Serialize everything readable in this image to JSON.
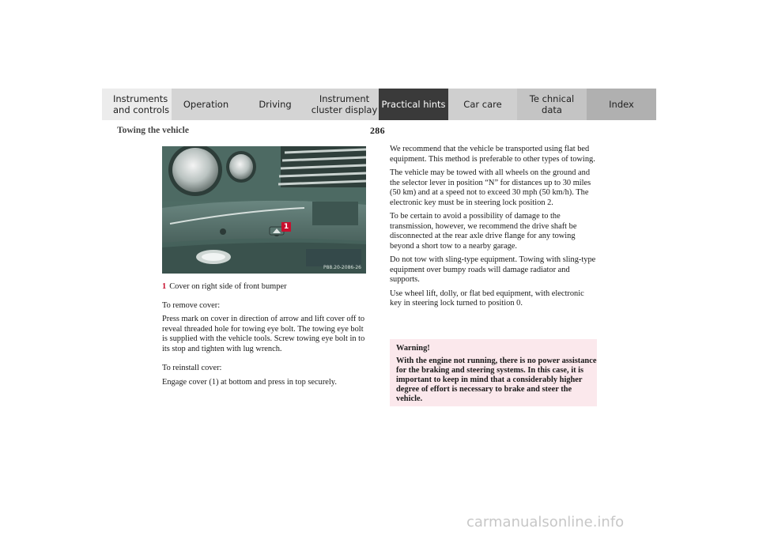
{
  "nav": {
    "tabs": [
      {
        "label": "Instruments and controls",
        "line1": "Instruments",
        "line2": "and controls"
      },
      {
        "label": "Operation"
      },
      {
        "label": "Driving"
      },
      {
        "label": "Instrument cluster display",
        "line1": "Instrument",
        "line2": "cluster display"
      },
      {
        "label": "Practical hints"
      },
      {
        "label": "Car care"
      },
      {
        "label": "Technical data",
        "line1": "Te chnical",
        "line2": "data"
      },
      {
        "label": "Index"
      }
    ],
    "active_tab": "Practical hints",
    "active_color": "#3a3a3a"
  },
  "header": {
    "page_number": "286",
    "section_title": "Towing the vehicle"
  },
  "figure": {
    "code": "P88.20-2086-26",
    "callout": "1",
    "caption_number": "1",
    "caption_text": "Cover on right side of front bumper"
  },
  "left": {
    "remove_heading": "To remove cover:",
    "remove_body": "Press mark on cover in direction of arrow and lift cover off to reveal threaded hole for towing eye bolt. The towing eye bolt is supplied with the vehicle tools. Screw towing eye bolt in to its stop and tighten with lug wrench.",
    "reinstall_heading": "To reinstall cover:",
    "reinstall_body": "Engage cover (1) at bottom and press in top securely."
  },
  "right": {
    "p1": "We recommend that the vehicle be transported using flat bed equipment. This method is preferable to other types of towing.",
    "p2": "The vehicle may be towed with all wheels on the ground and the selector lever in position “N” for distances up to 30 miles (50 km) and at a speed not to exceed 30 mph (50 km/h). The electronic key must be in steering lock position 2.",
    "p3": "To be certain to avoid a possibility of damage to the transmission, however, we recommend the drive shaft be disconnected at the rear axle drive flange for any towing beyond a short tow to a nearby garage.",
    "p4": "Do not tow with sling-type equipment. Towing with sling-type equipment over bumpy roads will damage radiator and supports.",
    "p5": "Use wheel lift, dolly, or flat bed equipment, with electronic key in steering lock turned to position 0."
  },
  "warning": {
    "title": "Warning!",
    "body": "With the engine not running, there is no power assistance for the braking and steering systems. In this case, it is important to keep in mind that a considerably higher degree of effort is necessary to brake and steer the vehicle.",
    "background": "#fbe8ec"
  },
  "watermark": "carmanualsonline.info",
  "colors": {
    "accent_red": "#c8102e"
  }
}
